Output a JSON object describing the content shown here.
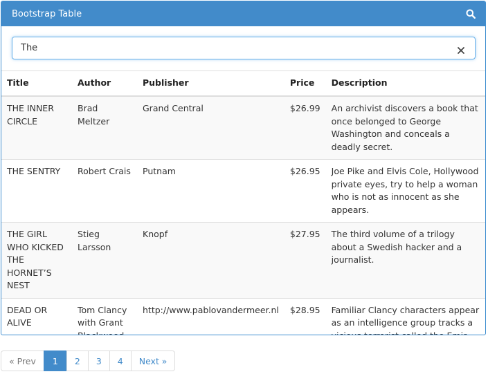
{
  "panel": {
    "title": "Bootstrap Table",
    "header_icon": "search-icon"
  },
  "search": {
    "value": "The",
    "clear_icon": "close-icon"
  },
  "table": {
    "headers": [
      "Title",
      "Author",
      "Publisher",
      "Price",
      "Description"
    ],
    "rows": [
      {
        "title": "THE INNER CIRCLE",
        "author": "Brad Meltzer",
        "publisher": "Grand Central",
        "price": "$26.99",
        "description": "An archivist discovers a book that once belonged to George Washington and conceals a deadly secret."
      },
      {
        "title": "THE SENTRY",
        "author": "Robert Crais",
        "publisher": "Putnam",
        "price": "$26.95",
        "description": "Joe Pike and Elvis Cole, Hollywood private eyes, try to help a woman who is not as innocent as she appears."
      },
      {
        "title": "THE GIRL WHO KICKED THE HORNET’S NEST",
        "author": "Stieg Larsson",
        "publisher": "Knopf",
        "price": "$27.95",
        "description": "The third volume of a trilogy about a Swedish hacker and a journalist."
      },
      {
        "title": "DEAD OR ALIVE",
        "author": "Tom Clancy with Grant Blackwood",
        "publisher": "http://www.pablovandermeer.nl",
        "price": "$28.95",
        "description": "Familiar Clancy characters appear as an intelligence group tracks a vicious terrorist called the Emir."
      }
    ]
  },
  "pagination": {
    "prev": "« Prev",
    "pages": [
      "1",
      "2",
      "3",
      "4"
    ],
    "active_page": "1",
    "next": "Next »"
  },
  "colors": {
    "primary": "#428bca",
    "border": "#dddddd",
    "stripe": "#f9f9f9"
  }
}
